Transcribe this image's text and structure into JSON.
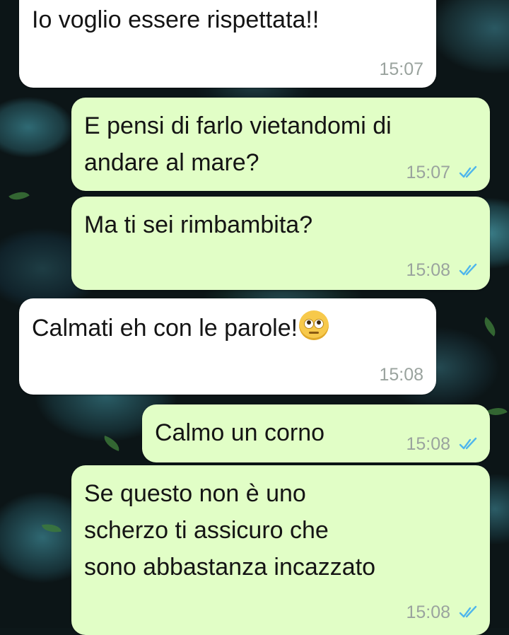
{
  "messages": [
    {
      "direction": "incoming",
      "text": "Io voglio essere rispettata!!",
      "time": "15:07"
    },
    {
      "direction": "outgoing",
      "lines": [
        "E pensi di farlo vietandomi di",
        "andare al mare?"
      ],
      "time": "15:07",
      "status": "read-double-check"
    },
    {
      "direction": "outgoing",
      "text": "Ma ti sei rimbambita?",
      "time": "15:08",
      "status": "read-double-check"
    },
    {
      "direction": "incoming",
      "text": "Calmati eh con le parole!",
      "emoji": "face-with-rolling-eyes",
      "time": "15:08"
    },
    {
      "direction": "outgoing",
      "text": "Calmo un corno",
      "time": "15:08",
      "status": "read-double-check"
    },
    {
      "direction": "outgoing",
      "lines": [
        "Se questo non è uno",
        "scherzo ti assicuro che",
        "sono abbastanza incazzato"
      ],
      "time": "15:08",
      "status": "read-double-check"
    }
  ],
  "colors": {
    "incoming_bubble": "#ffffff",
    "outgoing_bubble": "#e1fec6",
    "read_ticks": "#4fb6ec",
    "timestamp": "#9aa39e"
  },
  "wallpaper": "dark-teal-pebbles"
}
